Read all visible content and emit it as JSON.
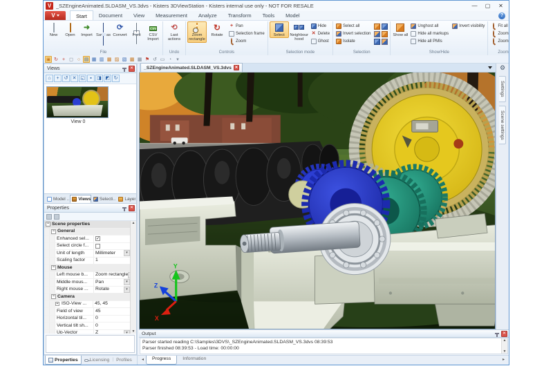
{
  "window": {
    "title": "_SZEngineAnimated.SLDASM_VS.3dvs - Kisters 3DViewStation - Kisters internal use only - NOT FOR RESALE",
    "app_initial": "V",
    "controls": {
      "minimize": "—",
      "maximize": "▢",
      "close": "✕"
    }
  },
  "ribbon": {
    "tabs": [
      "Start",
      "Document",
      "View",
      "Measurement",
      "Analyze",
      "Transform",
      "Tools",
      "Model"
    ],
    "active_tab": "Start",
    "help": "?",
    "file": {
      "label": "File",
      "new": "New",
      "open": "Open",
      "import": "Import",
      "save_as": "Save as",
      "convert": "Convert",
      "print": "Print",
      "csv_import": "CSV Import",
      "csv_icon_text": "CSV"
    },
    "undo": {
      "label": "Undo",
      "last_actions": "Last actions"
    },
    "controls": {
      "label": "Controls",
      "zoom_rectangle": "Zoom rectangle",
      "rotate": "Rotate",
      "pan": "Pan",
      "selection_frame": "Selection frame",
      "zoom": "Zoom"
    },
    "selection_mode": {
      "label": "Selection mode",
      "select": "Select",
      "neighbourhood": "Neighbour hood",
      "hide": "Hide",
      "delete": "Delete",
      "ghost": "Ghost"
    },
    "selection": {
      "label": "Selection",
      "select_all": "Select all",
      "invert_selection": "Invert selection",
      "isolate": "Isolate"
    },
    "show_hide": {
      "label": "Show/Hide",
      "show_all": "Show all",
      "unghost_all": "Unghost all",
      "hide_all_markups": "Hide all markups",
      "hide_all_pmis": "Hide all PMIs",
      "invert_visibility": "Invert visibility"
    },
    "zoom": {
      "label": "Zoom",
      "fit_all": "Fit all",
      "zoom_in": "Zoom in",
      "zoom_out": "Zoom out"
    }
  },
  "quick_toolbar": {
    "icons": [
      {
        "name": "zoom-rectangle-icon",
        "glyph": "▣",
        "active": true
      },
      {
        "name": "rotate-icon",
        "glyph": "↻"
      },
      {
        "name": "pan-icon",
        "glyph": "+"
      },
      {
        "name": "selection-frame-icon",
        "glyph": "◻"
      },
      {
        "name": "zoom-icon",
        "glyph": "○"
      },
      {
        "name": "select-icon",
        "glyph": "▤",
        "active": true
      },
      {
        "name": "neighbourhood-icon",
        "glyph": "▦"
      },
      {
        "name": "hide-icon",
        "glyph": "▥"
      },
      {
        "name": "select-all-icon",
        "glyph": "▩"
      },
      {
        "name": "invert-selection-icon",
        "glyph": "▨"
      },
      {
        "name": "isolate-icon",
        "glyph": "▧"
      },
      {
        "name": "show-all-icon",
        "glyph": "▩"
      },
      {
        "name": "unghost-icon",
        "glyph": "▦"
      },
      {
        "name": "flag-icon",
        "glyph": "⚑"
      },
      {
        "name": "refresh-icon",
        "glyph": "↺"
      },
      {
        "name": "frame-icon",
        "glyph": "▭"
      },
      {
        "name": "clock-icon",
        "glyph": "◔"
      },
      {
        "name": "more-caret-icon",
        "glyph": "▾"
      }
    ]
  },
  "views_panel": {
    "title": "Views",
    "toolbar": [
      "⌂",
      "+",
      "↺",
      "✕",
      "◱",
      "▪",
      "◨",
      "◩",
      "↻"
    ],
    "view_label": "View 0",
    "tabs": [
      "Model ...",
      "Views",
      "Selecti...",
      "Layer"
    ]
  },
  "properties_panel": {
    "title": "Properties",
    "scene_properties": "Scene properties",
    "general": "General",
    "mouse": "Mouse",
    "camera": "Camera",
    "rows": {
      "enhanced": {
        "label": "Enhanced sel...",
        "checked": true
      },
      "select_circle": {
        "label": "Select circle f...",
        "checked": false
      },
      "unit": {
        "label": "Unit of length",
        "value": "Millimeter"
      },
      "scaling": {
        "label": "Scaling factor",
        "value": "1"
      },
      "left_mouse": {
        "label": "Left mouse b...",
        "value": "Zoom rectangle"
      },
      "middle_mouse": {
        "label": "Middle mous...",
        "value": "Pan"
      },
      "right_mouse": {
        "label": "Right mouse ...",
        "value": "Rotate"
      },
      "iso_view": {
        "label": "ISO-View ...",
        "value": "45, 45"
      },
      "fov": {
        "label": "Field of view",
        "value": "45"
      },
      "htilt": {
        "label": "Horizontal til...",
        "value": "0"
      },
      "vtilt": {
        "label": "Vertical tilt sh...",
        "value": "0"
      },
      "up_vector": {
        "label": "Up-Vector",
        "value": "Z"
      }
    },
    "tabs": [
      "Properties",
      "Licensing",
      "Profiles"
    ]
  },
  "document": {
    "tab": "_SZEngineAnimated.SLDASM_VS.3dvs"
  },
  "right_panel": {
    "tabs": [
      "Settings",
      "Scene settings"
    ]
  },
  "viewport": {
    "axis": {
      "x": "X",
      "y": "Y",
      "z": "Z"
    }
  },
  "output": {
    "title": "Output",
    "lines": [
      "Parser started reading C:\\Samples\\3DVS\\_SZEngineAnimated.SLDASM_VS.3dvs 08:39:53",
      "Parser finished 08:39:53 - Load time: 00:00:00"
    ],
    "tabs": [
      "Progress",
      "Information"
    ]
  },
  "colors": {
    "active_highlight": "#fbd98a",
    "highlight_border": "#e0a23c",
    "close_red": "#d9534a",
    "app_red": "#c5271b",
    "yellow_gear": "#e2c217",
    "blue_gear": "#2233c0",
    "teal_gear": "#1d8674",
    "block_gray": "#d8dccb",
    "lawn_green": "#3c5a24"
  }
}
